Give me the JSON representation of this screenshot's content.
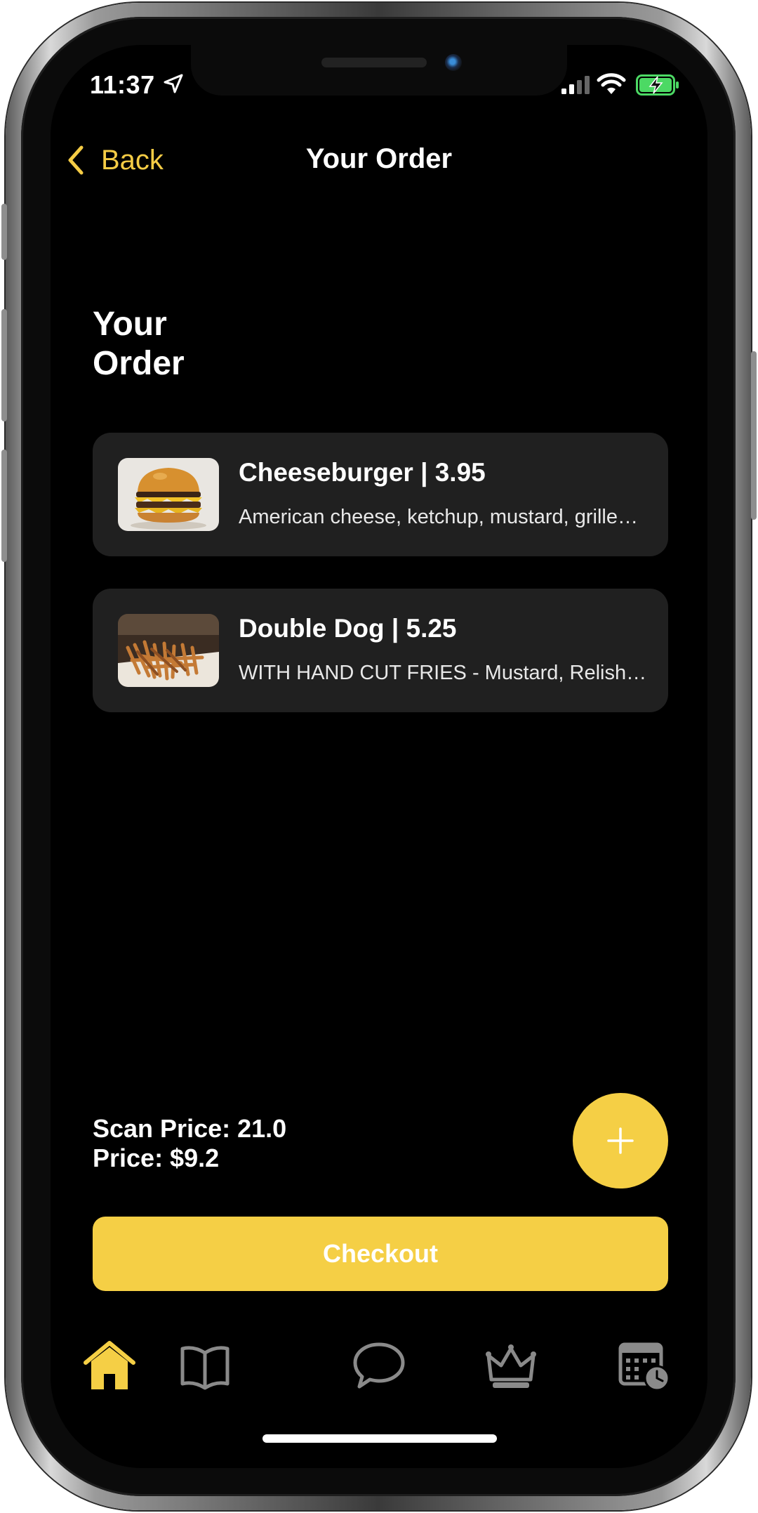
{
  "status_bar": {
    "time": "11:37"
  },
  "nav": {
    "back_label": "Back",
    "title": "Your Order"
  },
  "page_heading": "Your Order",
  "orders": [
    {
      "title": "Cheeseburger | 3.95",
      "description": "American cheese, ketchup, mustard, grilled onions",
      "image": "cheeseburger-photo"
    },
    {
      "title": "Double Dog | 5.25",
      "description": "WITH HAND CUT FRIES - Mustard, Relish, Onions",
      "image": "double-dog-photo"
    }
  ],
  "totals": {
    "scan_price": "Scan Price: 21.0",
    "price": "Price: $9.2"
  },
  "checkout_label": "Checkout",
  "tabs": [
    {
      "icon": "home-icon",
      "active": true
    },
    {
      "icon": "menu-book-icon",
      "active": false
    },
    {
      "icon": "chat-icon",
      "active": false
    },
    {
      "icon": "crown-icon",
      "active": false
    },
    {
      "icon": "calendar-clock-icon",
      "active": false
    }
  ],
  "colors": {
    "accent": "#f5cf45",
    "card": "#202020",
    "background": "#000000",
    "inactive_icon": "#8a8a8a"
  }
}
